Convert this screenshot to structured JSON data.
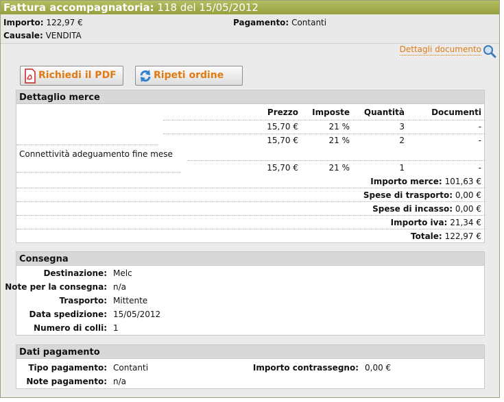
{
  "header": {
    "title_label": "Fattura accompagnatoria:",
    "title_value": "118 del 15/05/2012",
    "importo_label": "Importo:",
    "importo_value": "122,97 €",
    "pagamento_label": "Pagamento:",
    "pagamento_value": "Contanti",
    "causale_label": "Causale:",
    "causale_value": "VENDITA"
  },
  "details_link": "Dettagli documento",
  "buttons": {
    "pdf": "Richiedi il PDF",
    "repeat": "Ripeti ordine"
  },
  "merce": {
    "title": "Dettaglio merce",
    "columns": [
      "Prezzo",
      "Imposte",
      "Quantità",
      "Documenti"
    ],
    "rows": [
      {
        "desc": "",
        "prezzo": "15,70 €",
        "imposte": "21 %",
        "quantita": "3",
        "documenti": "-"
      },
      {
        "desc": "",
        "prezzo": "15,70 €",
        "imposte": "21 %",
        "quantita": "2",
        "documenti": "-"
      },
      {
        "desc": "Connettività adeguamento fine mese",
        "prezzo": "15,70 €",
        "imposte": "21 %",
        "quantita": "1",
        "documenti": "-"
      }
    ],
    "totals": [
      {
        "label": "Importo merce:",
        "value": "101,63 €"
      },
      {
        "label": "Spese di trasporto:",
        "value": "0,00 €"
      },
      {
        "label": "Spese di incasso:",
        "value": "0,00 €"
      },
      {
        "label": "Importo iva:",
        "value": "21,34 €"
      },
      {
        "label": "Totale:",
        "value": "122,97 €"
      }
    ]
  },
  "consegna": {
    "title": "Consegna",
    "rows": [
      {
        "label": "Destinazione:",
        "value": "Melc"
      },
      {
        "label": "Note per la consegna:",
        "value": "n/a"
      },
      {
        "label": "Trasporto:",
        "value": "Mittente"
      },
      {
        "label": "Data spedizione:",
        "value": "15/05/2012"
      },
      {
        "label": "Numero di colli:",
        "value": "1"
      }
    ]
  },
  "pagamento": {
    "title": "Dati pagamento",
    "tipo_label": "Tipo pagamento:",
    "tipo_value": "Contanti",
    "contrassegno_label": "Importo contrassegno:",
    "contrassegno_value": "0,00 €",
    "note_label": "Note pagamento:",
    "note_value": "n/a"
  },
  "colors": {
    "title_bar": "#a3ad4e",
    "accent_orange": "#e07c12"
  }
}
